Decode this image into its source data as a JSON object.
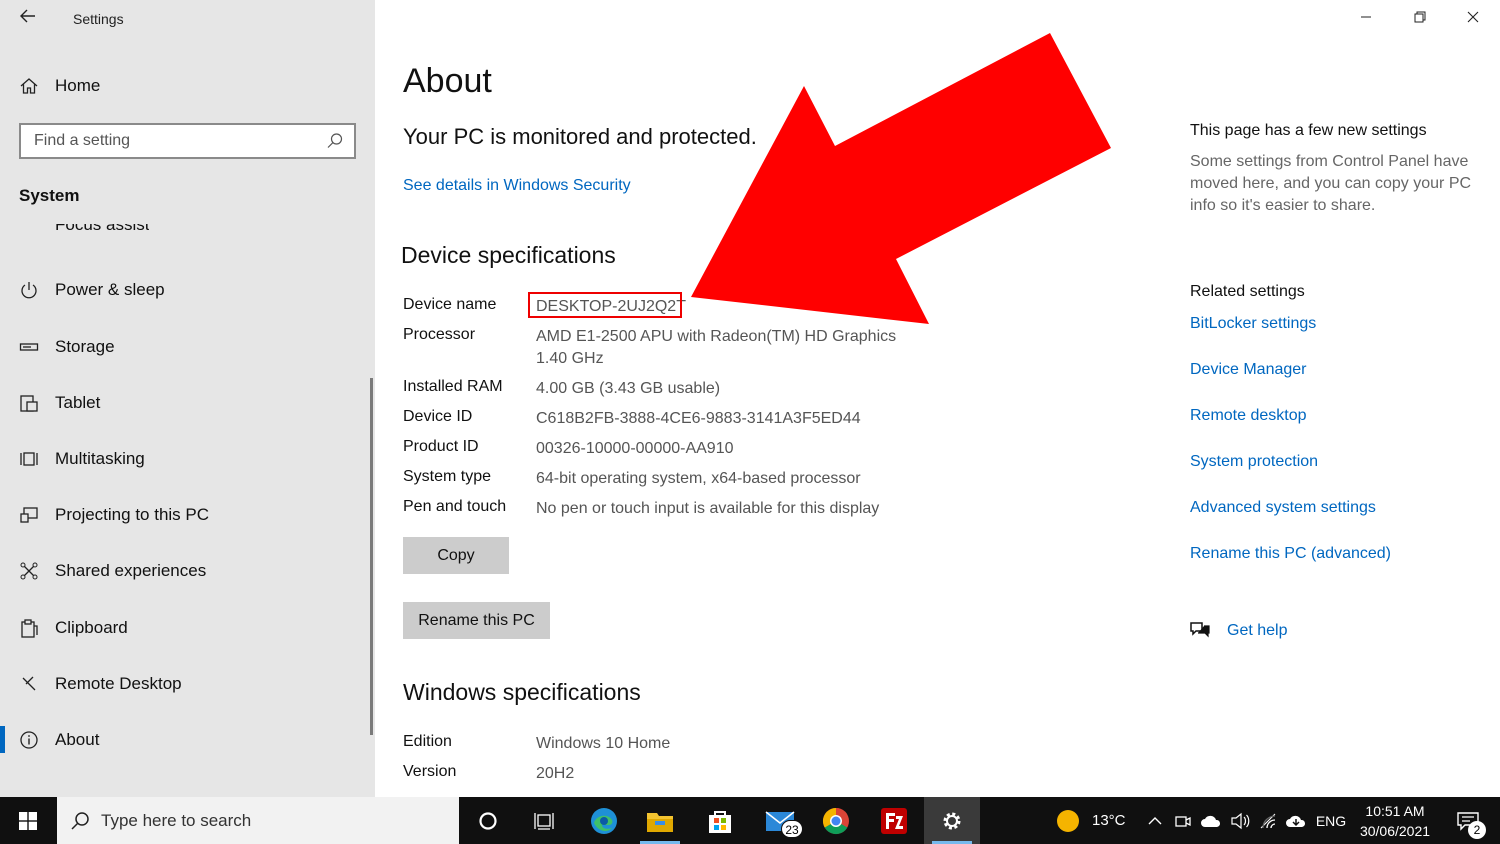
{
  "window": {
    "title": "Settings"
  },
  "sidebar": {
    "home": "Home",
    "search_placeholder": "Find a setting",
    "section": "System",
    "cut_item": "Focus assist",
    "items": [
      {
        "label": "Power & sleep",
        "icon": "power-icon"
      },
      {
        "label": "Storage",
        "icon": "storage-icon"
      },
      {
        "label": "Tablet",
        "icon": "tablet-icon"
      },
      {
        "label": "Multitasking",
        "icon": "multitasking-icon"
      },
      {
        "label": "Projecting to this PC",
        "icon": "projecting-icon"
      },
      {
        "label": "Shared experiences",
        "icon": "shared-icon"
      },
      {
        "label": "Clipboard",
        "icon": "clipboard-icon"
      },
      {
        "label": "Remote Desktop",
        "icon": "remote-desktop-icon"
      },
      {
        "label": "About",
        "icon": "info-icon",
        "active": true
      }
    ]
  },
  "main": {
    "title": "About",
    "protection_text": "Your PC is monitored and protected.",
    "security_link": "See details in Windows Security",
    "device_specs_title": "Device specifications",
    "device_specs": [
      {
        "key": "Device name",
        "value": "DESKTOP-2UJ2Q2T"
      },
      {
        "key": "Processor",
        "value": "AMD E1-2500 APU with Radeon(TM) HD Graphics",
        "value2": "1.40 GHz"
      },
      {
        "key": "Installed RAM",
        "value": "4.00 GB (3.43 GB usable)"
      },
      {
        "key": "Device ID",
        "value": "C618B2FB-3888-4CE6-9883-3141A3F5ED44"
      },
      {
        "key": "Product ID",
        "value": "00326-10000-00000-AA910"
      },
      {
        "key": "System type",
        "value": "64-bit operating system, x64-based processor"
      },
      {
        "key": "Pen and touch",
        "value": "No pen or touch input is available for this display"
      }
    ],
    "copy_button": "Copy",
    "rename_button": "Rename this PC",
    "windows_specs_title": "Windows specifications",
    "windows_specs": [
      {
        "key": "Edition",
        "value": "Windows 10 Home"
      },
      {
        "key": "Version",
        "value": "20H2"
      }
    ]
  },
  "side": {
    "heading": "This page has a few new settings",
    "text": "Some settings from Control Panel have moved here, and you can copy your PC info so it's easier to share.",
    "related_heading": "Related settings",
    "links": [
      "BitLocker settings",
      "Device Manager",
      "Remote desktop",
      "System protection",
      "Advanced system settings",
      "Rename this PC (advanced)"
    ],
    "help": "Get help"
  },
  "taskbar": {
    "search_placeholder": "Type here to search",
    "mail_badge": "23",
    "temperature": "13°C",
    "language": "ENG",
    "time": "10:51 AM",
    "date": "30/06/2021",
    "notification_count": "2"
  },
  "colors": {
    "accent": "#0067c0",
    "annotation_arrow": "#ff0000",
    "sidebar_bg": "#e6e6e6",
    "taskbar_bg": "#101010"
  }
}
